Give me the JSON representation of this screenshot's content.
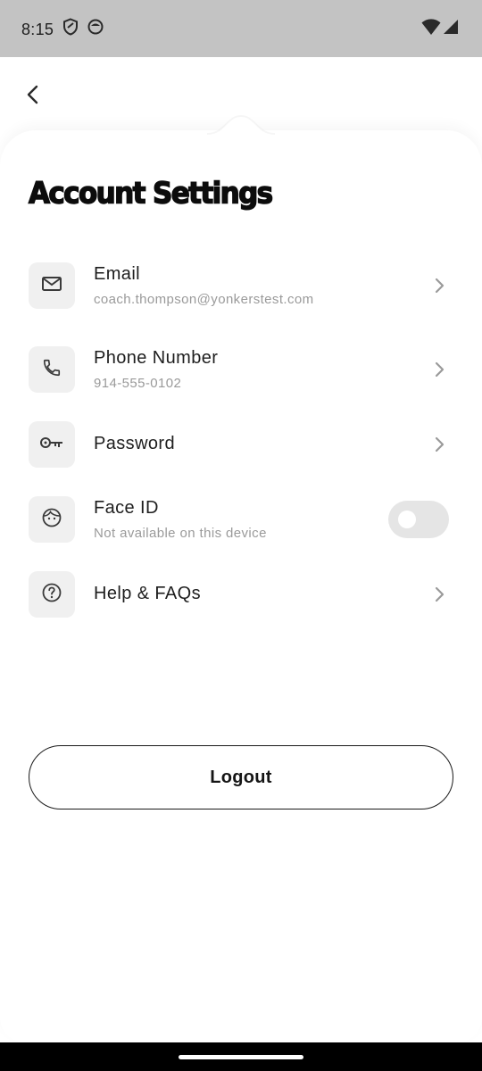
{
  "status_bar": {
    "time": "8:15",
    "left_icons": [
      "shield-icon",
      "face-app-icon"
    ],
    "right_icons": [
      "wifi-icon",
      "signal-icon"
    ]
  },
  "header": {
    "back_icon": "chevron-left-icon",
    "title": "Account Settings"
  },
  "settings": [
    {
      "id": "email",
      "icon": "mail-icon",
      "title": "Email",
      "subtitle": "coach.thompson@yonkerstest.com",
      "trailing": "chevron"
    },
    {
      "id": "phone",
      "icon": "phone-icon",
      "title": "Phone Number",
      "subtitle": "914-555-0102",
      "trailing": "chevron"
    },
    {
      "id": "password",
      "icon": "key-icon",
      "title": "Password",
      "trailing": "chevron"
    },
    {
      "id": "face-id",
      "icon": "face-icon",
      "title": "Face ID",
      "subtitle": "Not available on this device",
      "trailing": "toggle",
      "toggle_on": false,
      "disabled": true
    },
    {
      "id": "help",
      "icon": "help-circle-icon",
      "title": "Help & FAQs",
      "trailing": "chevron"
    }
  ],
  "logout": {
    "label": "Logout"
  },
  "colors": {
    "status_bar_bg": "#c3c3c3",
    "icon_box_bg": "#f0f0f0",
    "subtitle_text": "#9a9a9a",
    "toggle_track": "#e5e5e5",
    "nav_bar_bg": "#000000"
  }
}
